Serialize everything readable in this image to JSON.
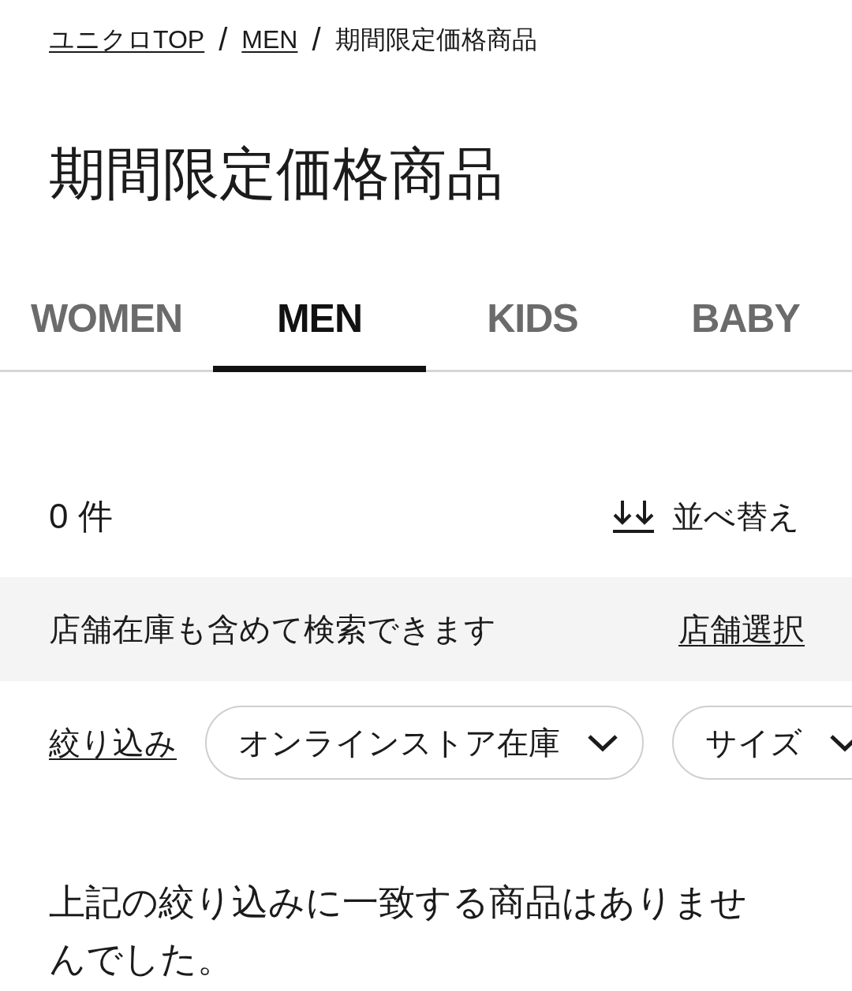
{
  "breadcrumb": {
    "separator": "/",
    "items": [
      {
        "label": "ユニクロTOP",
        "link": true
      },
      {
        "label": "MEN",
        "link": true
      },
      {
        "label": "期間限定価格商品",
        "link": false
      }
    ]
  },
  "title": "期間限定価格商品",
  "tabs": [
    {
      "label": "WOMEN",
      "selected": false
    },
    {
      "label": "MEN",
      "selected": true
    },
    {
      "label": "KIDS",
      "selected": false
    },
    {
      "label": "BABY",
      "selected": false
    }
  ],
  "result_count": "0 件",
  "sort": {
    "label": "並べ替え"
  },
  "store_banner": {
    "text": "店舗在庫も含めて検索できます",
    "link": "店舗選択"
  },
  "filters": {
    "label": "絞り込み",
    "chips": [
      {
        "label": "オンラインストア在庫"
      },
      {
        "label": "サイズ"
      }
    ]
  },
  "empty_message": "上記の絞り込みに一致する商品はありませんでした。"
}
